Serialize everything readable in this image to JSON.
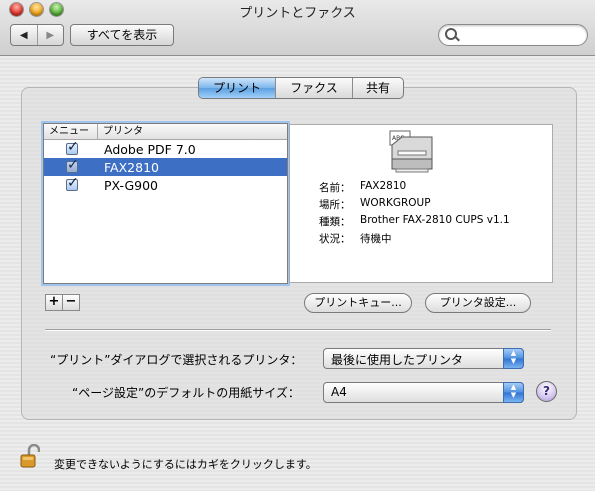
{
  "window": {
    "title": "プリントとファクス"
  },
  "toolbar": {
    "back_label": "◀",
    "forward_label": "▶",
    "show_all_label": "すべてを表示",
    "search_placeholder": ""
  },
  "tabs": [
    {
      "label": "プリント",
      "active": true
    },
    {
      "label": "ファクス",
      "active": false
    },
    {
      "label": "共有",
      "active": false
    }
  ],
  "printer_list": {
    "headers": {
      "menu": "メニュー",
      "printer": "プリンタ"
    },
    "rows": [
      {
        "name": "Adobe PDF 7.0",
        "checked": true,
        "selected": false
      },
      {
        "name": "FAX2810",
        "checked": true,
        "selected": true
      },
      {
        "name": "PX-G900",
        "checked": true,
        "selected": false
      }
    ]
  },
  "details": {
    "name_key": "名前：",
    "name_val": "FAX2810",
    "location_key": "場所：",
    "location_val": "WORKGROUP",
    "kind_key": "種類：",
    "kind_val": "Brother FAX-2810 CUPS v1.1",
    "status_key": "状況：",
    "status_val": "待機中",
    "icon_badge": "ABC"
  },
  "buttons": {
    "add": "+",
    "remove": "−",
    "print_queue": "プリントキュー...",
    "printer_setup": "プリンタ設定..."
  },
  "settings": {
    "selected_printer_label": "“プリント”ダイアログで選択されるプリンタ：",
    "selected_printer_value": "最後に使用したプリンタ",
    "paper_size_label": "“ページ設定”のデフォルトの用紙サイズ：",
    "paper_size_value": "A4",
    "help": "?"
  },
  "lock": {
    "text": "変更できないようにするにはカギをクリックします。"
  },
  "colors": {
    "selection": "#3d6fc5",
    "active_tab": "#7cb6ec"
  }
}
